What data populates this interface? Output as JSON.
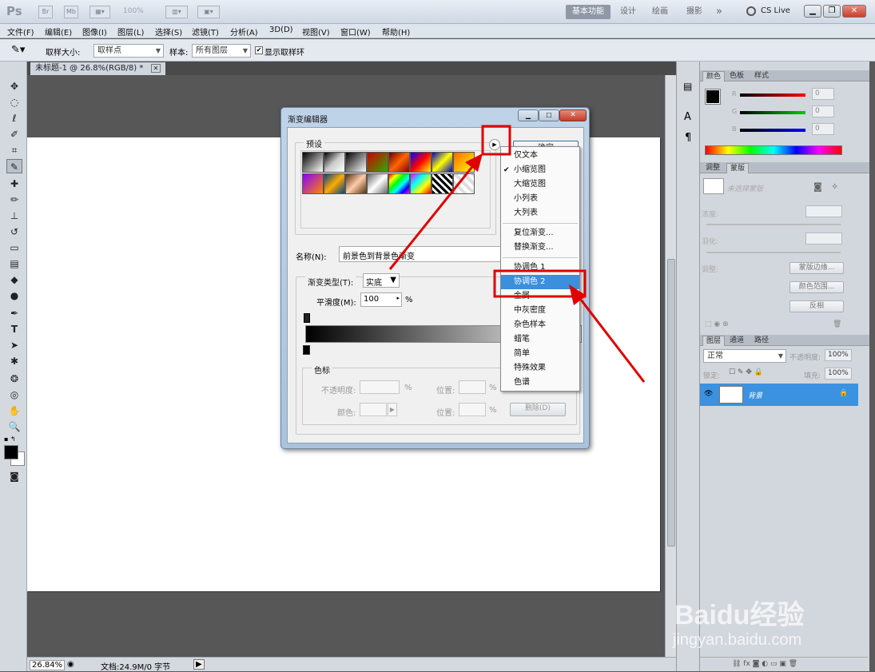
{
  "app": {
    "logo": "Ps",
    "zoom_display": "100%",
    "workspaces": [
      "基本功能",
      "设计",
      "绘画",
      "摄影"
    ],
    "more": "»",
    "cslive": "CS Live"
  },
  "menubar": [
    "文件(F)",
    "编辑(E)",
    "图像(I)",
    "图层(L)",
    "选择(S)",
    "滤镜(T)",
    "分析(A)",
    "3D(D)",
    "视图(V)",
    "窗口(W)",
    "帮助(H)"
  ],
  "options": {
    "sample_size_label": "取样大小:",
    "sample_size_value": "取样点",
    "sample_label": "样本:",
    "sample_value": "所有图层",
    "show_ring_label": "显示取样环"
  },
  "document": {
    "tab_title": "未标题-1 @ 26.8%(RGB/8) *",
    "status_zoom": "26.84%",
    "status_doc": "文档:24.9M/0 字节"
  },
  "colors": {
    "accent": "#3b8fdc",
    "annotation_red": "#e00000",
    "layer_selected": "#3a92e0"
  },
  "panels": {
    "color_tabs": [
      "颜色",
      "色板",
      "样式"
    ],
    "rgb_labels": [
      "R",
      "G",
      "B"
    ],
    "rgb_values": [
      "0",
      "0",
      "0"
    ],
    "adjust_tabs": [
      "调整",
      "蒙版"
    ],
    "mask_label": "未选择蒙版",
    "density_label": "浓度:",
    "feather_label": "羽化:",
    "adjust_label": "调整:",
    "mask_edge_btn": "蒙版边缘...",
    "color_range_btn": "颜色范围...",
    "invert_btn": "反相",
    "layer_tabs": [
      "图层",
      "通道",
      "路径"
    ],
    "blend_mode": "正常",
    "opacity_label": "不透明度:",
    "opacity_value": "100%",
    "lock_label": "锁定:",
    "fill_label": "填充:",
    "fill_value": "100%",
    "layer_name": "背景"
  },
  "dialog": {
    "title": "渐变编辑器",
    "presets_label": "预设",
    "ok_label": "确定",
    "name_label": "名称(N):",
    "name_value": "前景色到背景色渐变",
    "type_label": "渐变类型(T):",
    "type_value": "实底",
    "smooth_label": "平滑度(M):",
    "smooth_value": "100",
    "percent": "%",
    "stops_label": "色标",
    "opacity_label": "不透明度:",
    "position_label": "位置:",
    "color_label": "颜色:",
    "delete_label": "删除(D)",
    "pct": "%"
  },
  "context_menu": {
    "items": [
      {
        "label": "仅文本",
        "checked": false
      },
      {
        "label": "小缩览图",
        "checked": true
      },
      {
        "label": "大缩览图",
        "checked": false
      },
      {
        "label": "小列表",
        "checked": false
      },
      {
        "label": "大列表",
        "checked": false
      },
      {
        "label": "复位渐变...",
        "checked": false
      },
      {
        "label": "替换渐变...",
        "checked": false
      },
      {
        "label": "协调色 1",
        "checked": false
      },
      {
        "label": "协调色 2",
        "checked": false,
        "highlighted": true
      },
      {
        "label": "金属",
        "checked": false
      },
      {
        "label": "中灰密度",
        "checked": false
      },
      {
        "label": "杂色样本",
        "checked": false
      },
      {
        "label": "蜡笔",
        "checked": false
      },
      {
        "label": "简单",
        "checked": false
      },
      {
        "label": "特殊效果",
        "checked": false
      },
      {
        "label": "色谱",
        "checked": false
      }
    ],
    "checkmark": "✔"
  },
  "watermark": {
    "brand": "Baidu经验",
    "url": "jingyan.baidu.com"
  }
}
